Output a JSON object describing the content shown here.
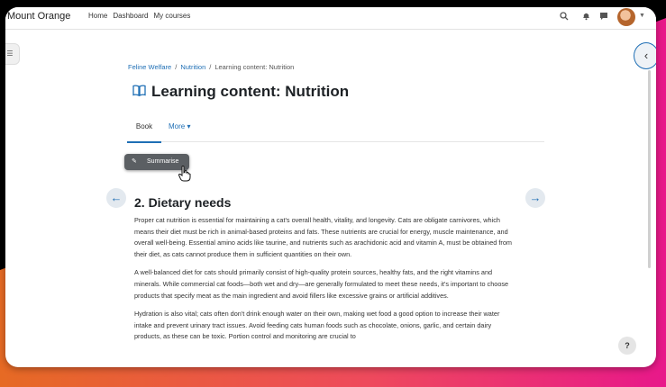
{
  "site": {
    "name": "Mount Orange"
  },
  "nav": {
    "links": [
      "Home",
      "Dashboard",
      "My courses"
    ]
  },
  "header_icons": [
    "search-icon",
    "bell-icon",
    "chat-icon",
    "avatar",
    "chevron-down-icon"
  ],
  "breadcrumb": {
    "items": [
      "Feline Welfare",
      "Nutrition",
      "Learning content: Nutrition"
    ],
    "separator": "/"
  },
  "page": {
    "title": "Learning content: Nutrition"
  },
  "tabs": {
    "book": "Book",
    "more": "More ▾"
  },
  "summarise": {
    "label": "Summarise"
  },
  "section": {
    "title": "2. Dietary needs",
    "paragraphs": [
      "Proper cat nutrition is essential for maintaining a cat's overall health, vitality, and longevity. Cats are obligate carnivores, which means their diet must be rich in animal-based proteins and fats. These nutrients are crucial for energy, muscle maintenance, and overall well-being. Essential amino acids like taurine, and nutrients such as arachidonic acid and vitamin A, must be obtained from their diet, as cats cannot produce them in sufficient quantities on their own.",
      "A well-balanced diet for cats should primarily consist of high-quality protein sources, healthy fats, and the right vitamins and minerals. While commercial cat foods—both wet and dry—are generally formulated to meet these needs, it's important to choose products that specify meat as the main ingredient and avoid fillers like excessive grains or artificial additives.",
      "Hydration is also vital; cats often don't drink enough water on their own, making wet food a good option to increase their water intake and prevent urinary tract issues. Avoid feeding cats human foods such as chocolate, onions, garlic, and certain dairy products, as these can be toxic. Portion control and monitoring are crucial to"
    ]
  },
  "help": {
    "label": "?"
  },
  "colors": {
    "accent": "#1f6fb5",
    "button_dark": "#5b5f63"
  }
}
